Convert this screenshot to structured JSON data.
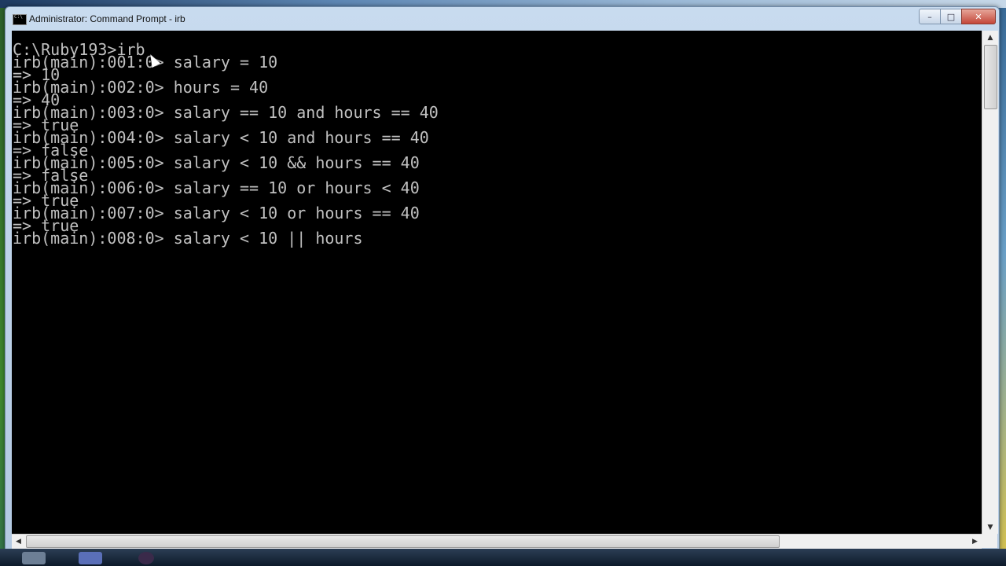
{
  "window": {
    "title": "Administrator: Command Prompt - irb",
    "minimize_label": "–",
    "maximize_label": "□",
    "close_label": "✕"
  },
  "console": {
    "lines": [
      "C:\\Ruby193>irb",
      "irb(main):001:0> salary = 10",
      "=> 10",
      "irb(main):002:0> hours = 40",
      "=> 40",
      "irb(main):003:0> salary == 10 and hours == 40",
      "=> true",
      "irb(main):004:0> salary < 10 and hours == 40",
      "=> false",
      "irb(main):005:0> salary < 10 && hours == 40",
      "=> false",
      "irb(main):006:0> salary == 10 or hours < 40",
      "=> true",
      "irb(main):007:0> salary < 10 or hours == 40",
      "=> true",
      "irb(main):008:0> salary < 10 || hours"
    ],
    "background": "#000000",
    "text_color": "#c0c0c0"
  },
  "icons": {
    "app": "cmd-icon",
    "cursor": "mouse-pointer-icon"
  }
}
